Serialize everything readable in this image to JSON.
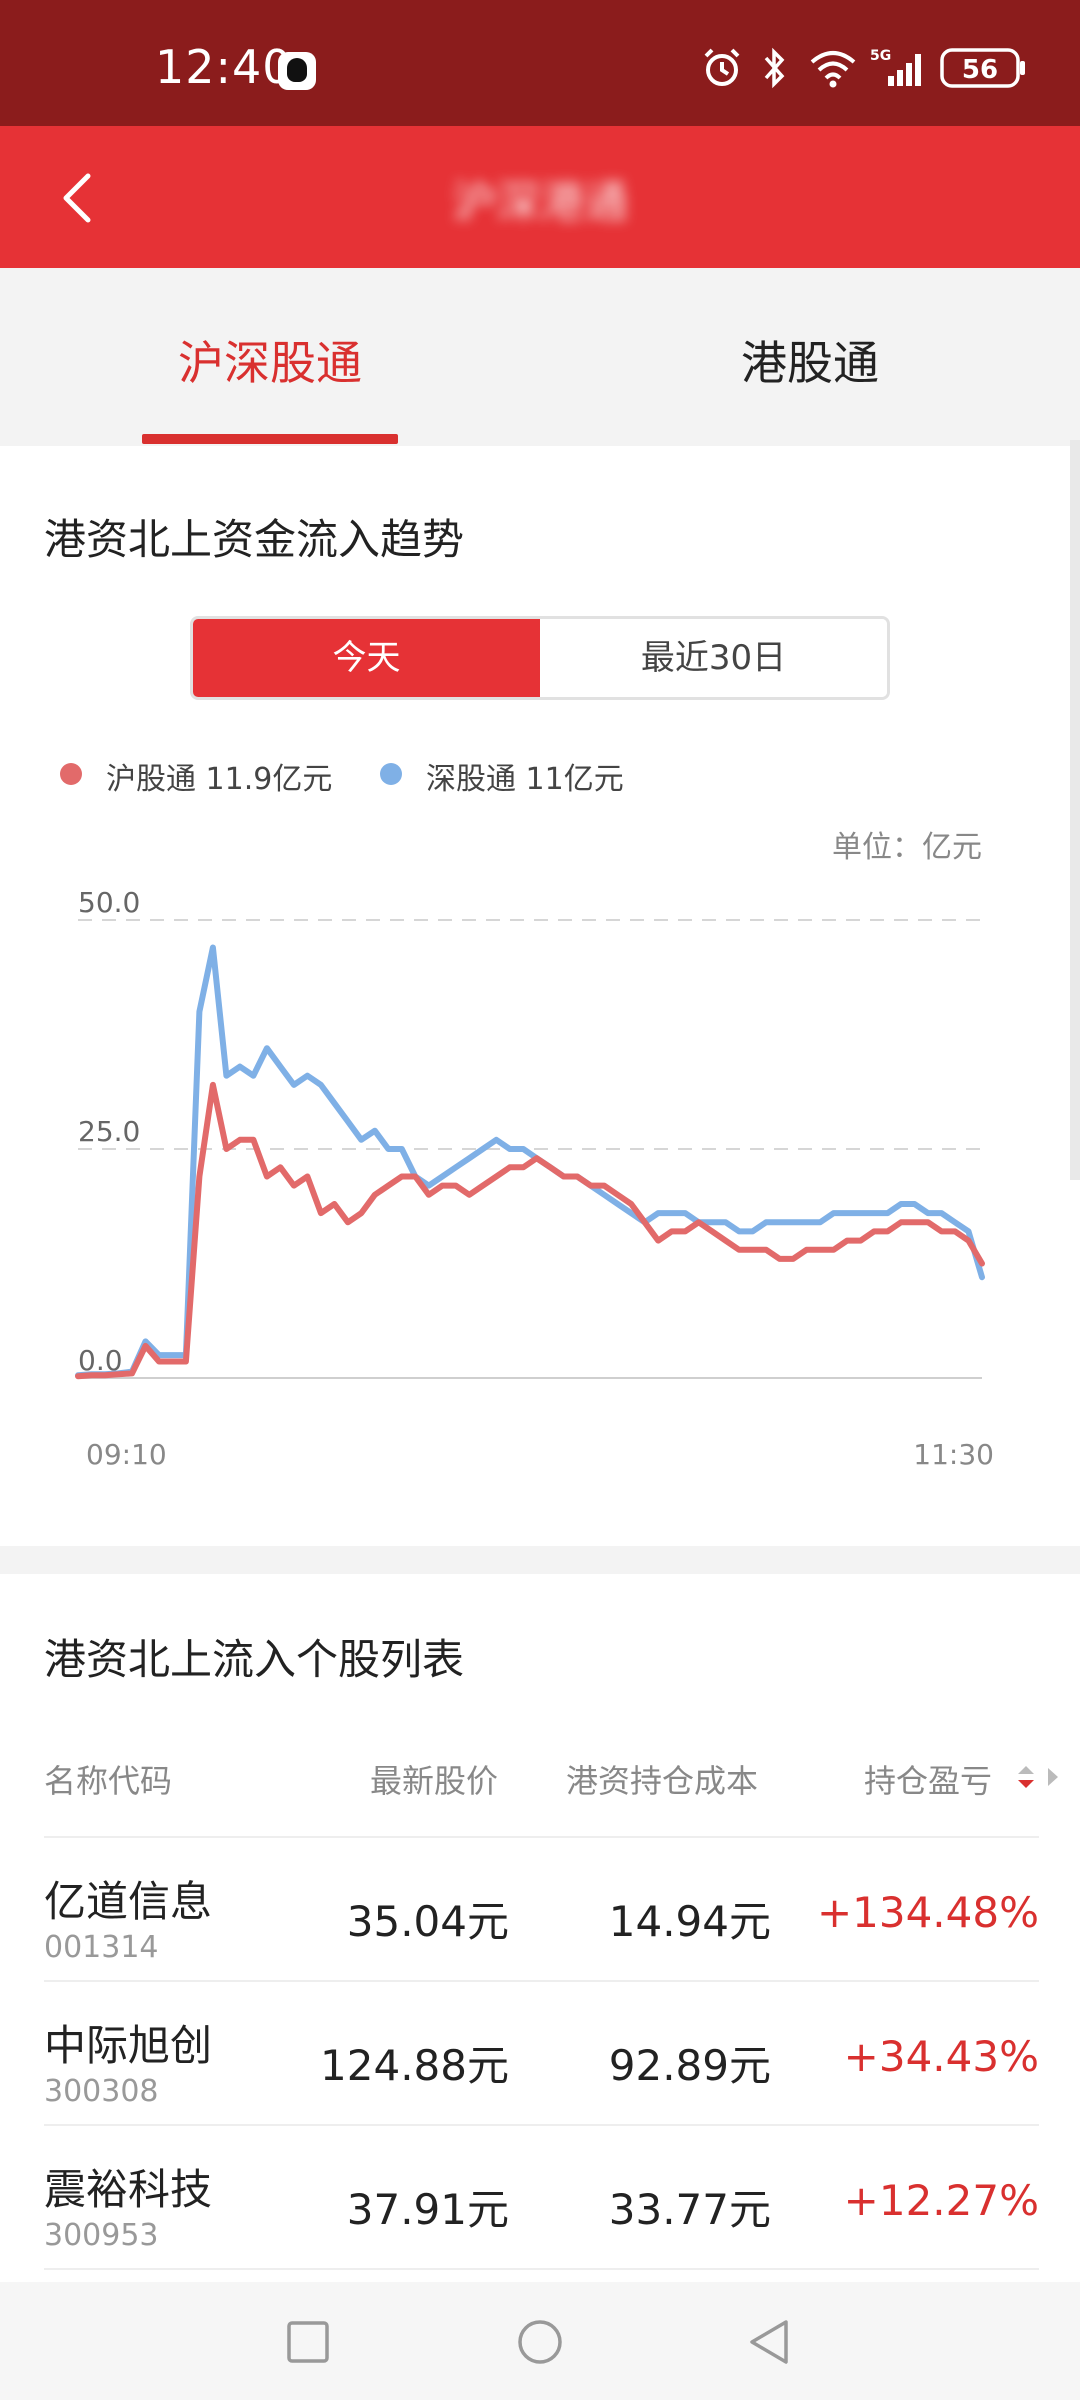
{
  "status_bar": {
    "time": "12:40",
    "battery": "56",
    "network": "5G"
  },
  "header": {
    "title": "沪深港通"
  },
  "tabs": [
    {
      "label": "沪深股通",
      "active": true
    },
    {
      "label": "港股通",
      "active": false
    }
  ],
  "trend": {
    "title": "港资北上资金流入趋势",
    "range_options": [
      {
        "label": "今天",
        "active": true
      },
      {
        "label": "最近30日",
        "active": false
      }
    ],
    "legend": [
      {
        "label": "沪股通 11.9亿元",
        "color": "#e26a6a"
      },
      {
        "label": "深股通 11亿元",
        "color": "#7fb0e6"
      }
    ],
    "unit": "单位：亿元"
  },
  "chart_data": {
    "type": "line",
    "x_start": "09:10",
    "x_end": "11:30",
    "y_ticks": [
      "50.0",
      "25.0",
      "0.0"
    ],
    "ylim": [
      0,
      50
    ],
    "grid": true,
    "legend_position": "top-left",
    "series": [
      {
        "name": "沪股通",
        "color": "#e26a6a",
        "values": [
          0.2,
          0.3,
          0.3,
          0.4,
          0.5,
          3.5,
          1.8,
          1.8,
          1.8,
          22,
          32,
          25,
          26,
          26,
          22,
          23,
          21,
          22,
          18,
          19,
          17,
          18,
          20,
          21,
          22,
          22,
          20,
          21,
          21,
          20,
          21,
          22,
          23,
          23,
          24,
          23,
          22,
          22,
          21,
          21,
          20,
          19,
          17,
          15,
          16,
          16,
          17,
          16,
          15,
          14,
          14,
          14,
          13,
          13,
          14,
          14,
          14,
          15,
          15,
          16,
          16,
          17,
          17,
          17,
          16,
          16,
          15,
          12.5
        ],
        "annotation": "11.9亿元"
      },
      {
        "name": "深股通",
        "color": "#7fb0e6",
        "values": [
          0.3,
          0.4,
          0.4,
          0.5,
          0.7,
          4,
          2.5,
          2.5,
          2.5,
          40,
          47,
          33,
          34,
          33,
          36,
          34,
          32,
          33,
          32,
          30,
          28,
          26,
          27,
          25,
          25,
          22,
          21,
          22,
          23,
          24,
          25,
          26,
          25,
          25,
          24,
          23,
          22,
          22,
          21,
          20,
          19,
          18,
          17,
          18,
          18,
          18,
          17,
          17,
          17,
          16,
          16,
          17,
          17,
          17,
          17,
          17,
          18,
          18,
          18,
          18,
          18,
          19,
          19,
          18,
          18,
          17,
          16,
          11
        ],
        "annotation": "11亿元"
      }
    ]
  },
  "stocks": {
    "title": "港资北上流入个股列表",
    "columns": [
      "名称代码",
      "最新股价",
      "港资持仓成本",
      "持仓盈亏"
    ],
    "rows": [
      {
        "name": "亿道信息",
        "code": "001314",
        "price": "35.04元",
        "cost": "14.94元",
        "pnl": "+134.48%"
      },
      {
        "name": "中际旭创",
        "code": "300308",
        "price": "124.88元",
        "cost": "92.89元",
        "pnl": "+34.43%"
      },
      {
        "name": "震裕科技",
        "code": "300953",
        "price": "37.91元",
        "cost": "33.77元",
        "pnl": "+12.27%"
      }
    ]
  },
  "nav": {
    "icons": [
      "square-icon",
      "circle-icon",
      "back-triangle-icon"
    ]
  }
}
